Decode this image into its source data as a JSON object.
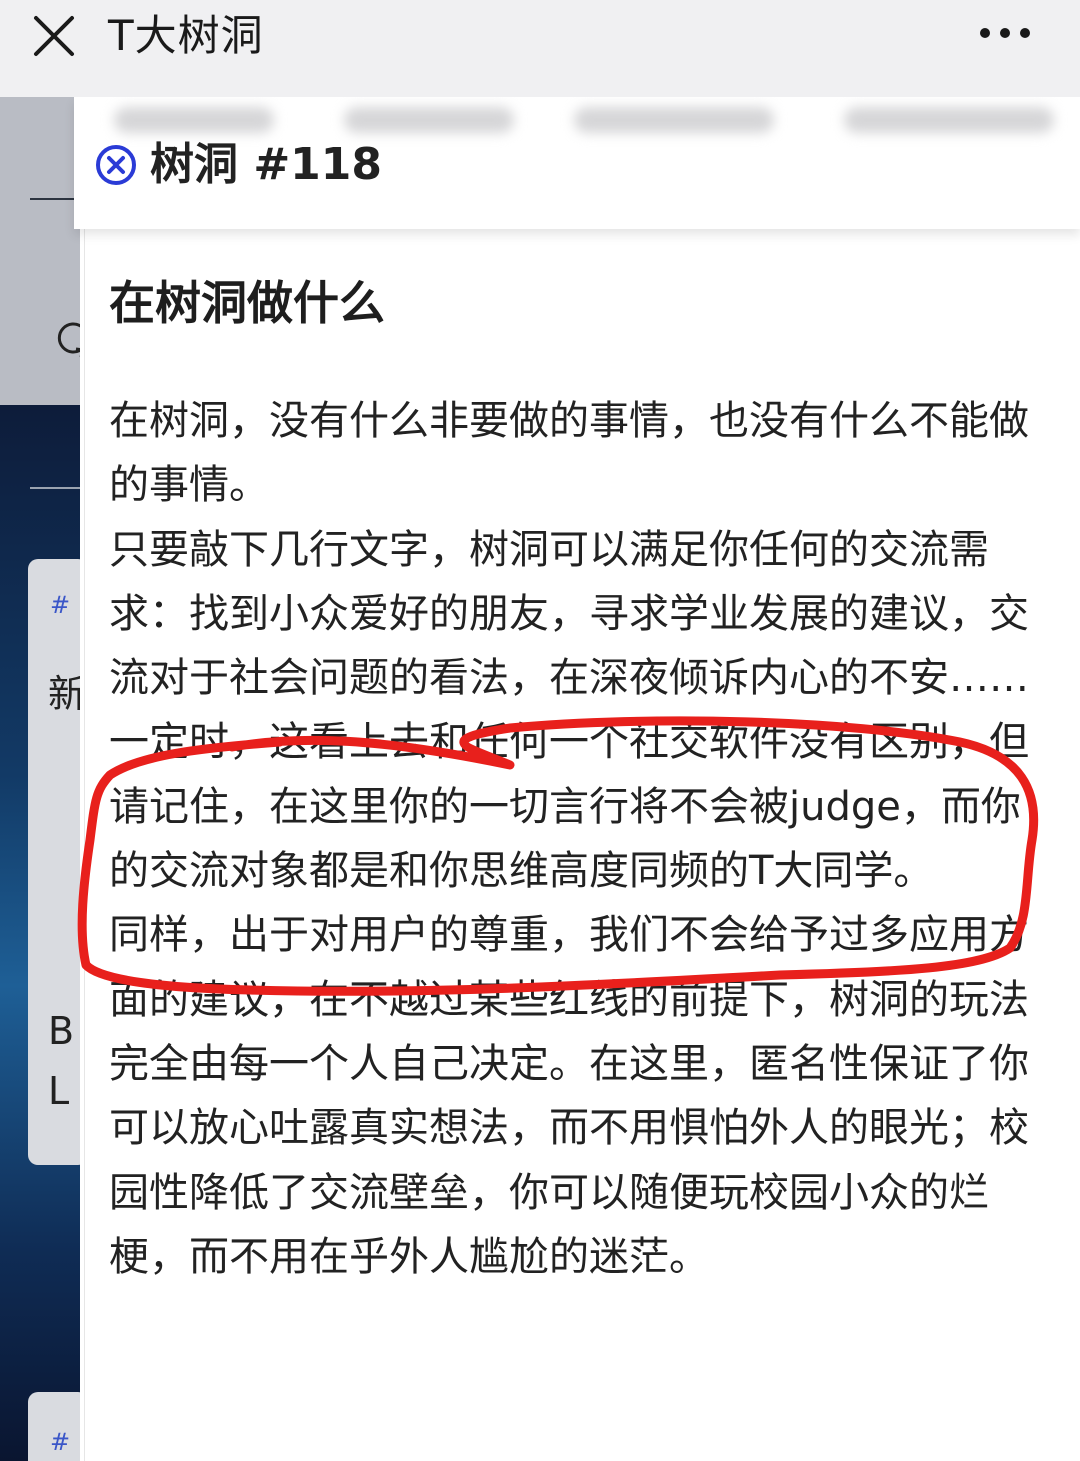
{
  "top_bar": {
    "title": "T大树洞"
  },
  "background_page": {
    "card_tag": "#",
    "card_text_1": "新",
    "card_text_2": "B",
    "card_text_3": "L",
    "card2_tag": "#"
  },
  "panel": {
    "hole_id": "树洞 #118"
  },
  "article": {
    "heading": "在树洞做什么",
    "paragraphs": [
      "在树洞，没有什么非要做的事情，也没有什么不能做的事情。",
      "只要敲下几行文字，树洞可以满足你任何的交流需求：找到小众爱好的朋友，寻求学业发展的建议，交流对于社会问题的看法，在深夜倾诉内心的不安……一定时，这看上去和任何一个社交软件没有区别，但请记住，在这里你的一切言行将不会被judge，而你的交流对象都是和你思维高度同频的T大同学。",
      "同样，出于对用户的尊重，我们不会给予过多应用方面的建议，在不越过某些红线的前提下，树洞的玩法完全由每一个人自己决定。在这里，匿名性保证了你可以放心吐露真实想法，而不用惧怕外人的眼光；校园性降低了交流壁垒，你可以随便玩校园小众的烂梗，而不用在乎外人尴尬的迷茫。"
    ]
  },
  "colors": {
    "top_bar_bg": "#f0f0f2",
    "accent_blue": "#2a3bd6",
    "annotation_red": "#e8201c",
    "text": "#222222"
  },
  "icons": {
    "close": "close-icon",
    "more": "more-dots-icon",
    "hole_close": "circle-x-icon",
    "refresh": "refresh-icon"
  }
}
